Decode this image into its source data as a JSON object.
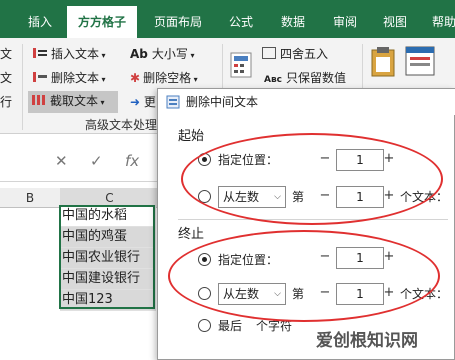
{
  "tabs": [
    {
      "label": "插入"
    },
    {
      "label": "方方格子"
    },
    {
      "label": "页面布局"
    },
    {
      "label": "公式"
    },
    {
      "label": "数据"
    },
    {
      "label": "审阅"
    },
    {
      "label": "视图"
    },
    {
      "label": "帮助"
    }
  ],
  "ribbon": {
    "left_chars": [
      "文",
      "文",
      "行"
    ],
    "insert_text": "插入文本",
    "delete_text": "删除文本",
    "extract_text": "截取文本",
    "case_text": "大小写",
    "case_prefix": "Ab",
    "delete_space": "删除空格",
    "more_prefix": "更",
    "round": "四舍五入",
    "keep_numeric": "只保留数值",
    "keep_prefix": "Aвс",
    "group_label": "高级文本处理",
    "colors": {
      "tab_green": "#217346",
      "ribbon_bg": "#f3f3f3"
    }
  },
  "formula": {
    "cancel": "✕",
    "confirm": "✓",
    "fx": "fx"
  },
  "sheet": {
    "columns": [
      "B",
      "C"
    ],
    "cells": [
      "中国的水稻",
      "中国的鸡蛋",
      "中国农业银行",
      "中国建设银行",
      "中国123"
    ]
  },
  "dialog": {
    "title": "删除中间文本",
    "start_section": "起始",
    "end_section": "终止",
    "specify_position": "指定位置：",
    "from_left": "从左数",
    "nth": "第",
    "text_unit": "个文本：",
    "start_value_1": "1",
    "start_value_2": "1",
    "end_value_1": "1",
    "end_value_2": "1",
    "minus": "−",
    "plus": "+",
    "last_char_prefix": "最后",
    "last_char_suffix": "个字符"
  },
  "watermark": "爱创根知识网"
}
